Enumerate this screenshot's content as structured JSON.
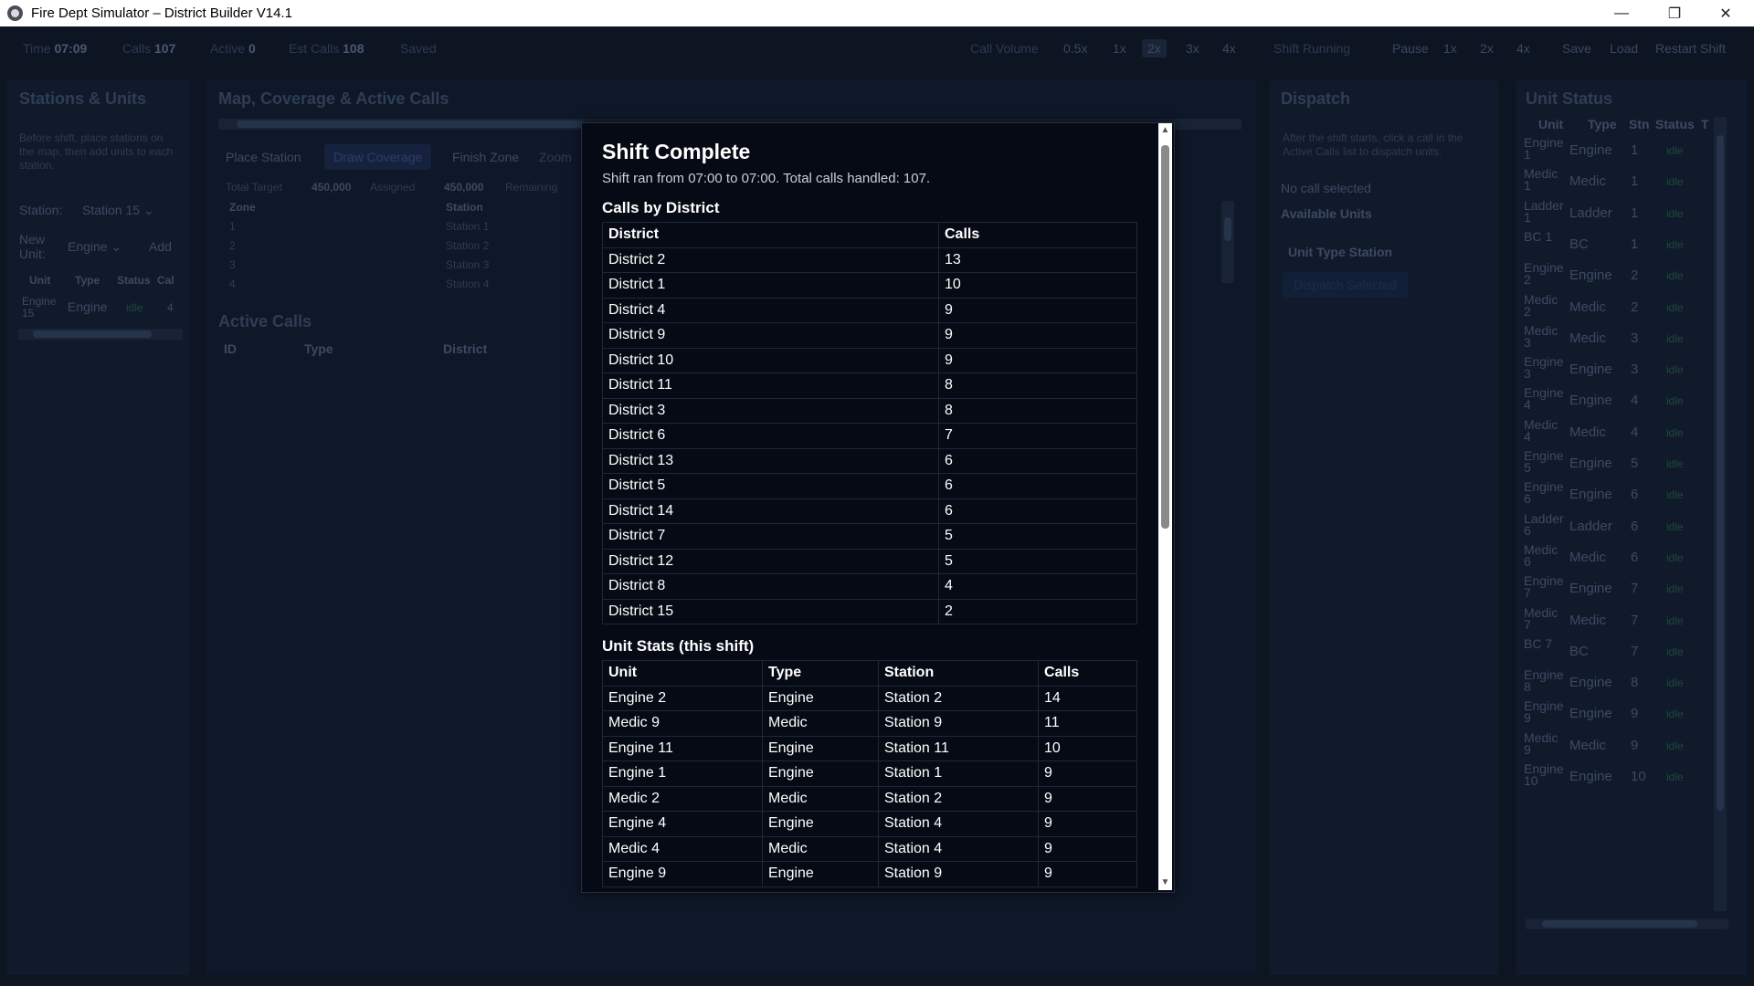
{
  "window": {
    "title": "Fire Dept Simulator – District Builder V14.1",
    "controls": [
      "—",
      "❐",
      "✕"
    ]
  },
  "topbar": {
    "time_label": "Time",
    "time_value": "07:09",
    "calls_label": "Calls",
    "calls_value": "107",
    "active_label": "Active",
    "active_value": "0",
    "est_label": "Est Calls",
    "est_value": "108",
    "saved": "Saved",
    "call_volume_label": "Call Volume",
    "volume_options": [
      "0.5x",
      "1x",
      "2x",
      "3x",
      "4x"
    ],
    "shift_running": "Shift Running",
    "pause": "Pause",
    "speed_options": [
      "1x",
      "2x",
      "4x"
    ],
    "save": "Save",
    "load": "Load",
    "restart": "Restart Shift"
  },
  "stations_panel": {
    "title": "Stations & Units",
    "help": "Before shift, place stations on the map, then add units to each station.",
    "station_label": "Station:",
    "station_value": "Station 15",
    "new_unit_label": "New Unit:",
    "new_unit_value": "Engine",
    "add": "Add",
    "cols": [
      "Unit",
      "Type",
      "Status",
      "Cal"
    ],
    "row": {
      "unit": "Engine 15",
      "type": "Engine",
      "status": "idle",
      "calls": "4"
    }
  },
  "map_panel": {
    "title": "Map, Coverage & Active Calls",
    "tools": [
      "Place Station",
      "Draw Coverage",
      "Finish Zone",
      "Zoom"
    ],
    "total_target_label": "Total Target",
    "total_target": "450,000",
    "assigned_label": "Assigned",
    "assigned": "450,000",
    "remaining_label": "Remaining",
    "zone_cols": [
      "Zone",
      "Station"
    ],
    "zones": [
      [
        "1",
        "Station 1"
      ],
      [
        "2",
        "Station 2"
      ],
      [
        "3",
        "Station 3"
      ],
      [
        "4",
        "Station 4"
      ]
    ],
    "active_calls_title": "Active Calls",
    "active_cols": [
      "ID",
      "Type",
      "District"
    ]
  },
  "dispatch_panel": {
    "title": "Dispatch",
    "help": "After the shift starts, click a call in the Active Calls list to dispatch units.",
    "no_call": "No call selected",
    "available": "Available Units",
    "cols": "Unit Type Station",
    "dispatch_btn": "Dispatch Selected"
  },
  "unit_status": {
    "title": "Unit Status",
    "cols": [
      "Unit",
      "Type",
      "Stn",
      "Status",
      "T"
    ],
    "rows": [
      [
        "Engine 1",
        "Engine",
        "1",
        "idle"
      ],
      [
        "Medic 1",
        "Medic",
        "1",
        "idle"
      ],
      [
        "Ladder 1",
        "Ladder",
        "1",
        "idle"
      ],
      [
        "BC 1",
        "BC",
        "1",
        "idle"
      ],
      [
        "Engine 2",
        "Engine",
        "2",
        "idle"
      ],
      [
        "Medic 2",
        "Medic",
        "2",
        "idle"
      ],
      [
        "Medic 3",
        "Medic",
        "3",
        "idle"
      ],
      [
        "Engine 3",
        "Engine",
        "3",
        "idle"
      ],
      [
        "Engine 4",
        "Engine",
        "4",
        "idle"
      ],
      [
        "Medic 4",
        "Medic",
        "4",
        "idle"
      ],
      [
        "Engine 5",
        "Engine",
        "5",
        "idle"
      ],
      [
        "Engine 6",
        "Engine",
        "6",
        "idle"
      ],
      [
        "Ladder 6",
        "Ladder",
        "6",
        "idle"
      ],
      [
        "Medic 6",
        "Medic",
        "6",
        "idle"
      ],
      [
        "Engine 7",
        "Engine",
        "7",
        "idle"
      ],
      [
        "Medic 7",
        "Medic",
        "7",
        "idle"
      ],
      [
        "BC 7",
        "BC",
        "7",
        "idle"
      ],
      [
        "Engine 8",
        "Engine",
        "8",
        "idle"
      ],
      [
        "Engine 9",
        "Engine",
        "9",
        "idle"
      ],
      [
        "Medic 9",
        "Medic",
        "9",
        "idle"
      ],
      [
        "Engine 10",
        "Engine",
        "10",
        "idle"
      ]
    ]
  },
  "modal": {
    "title": "Shift Complete",
    "summary": "Shift ran from 07:00 to 07:00. Total calls handled: 107.",
    "districts_title": "Calls by District",
    "district_cols": [
      "District",
      "Calls"
    ],
    "districts": [
      [
        "District 2",
        "13"
      ],
      [
        "District 1",
        "10"
      ],
      [
        "District 4",
        "9"
      ],
      [
        "District 9",
        "9"
      ],
      [
        "District 10",
        "9"
      ],
      [
        "District 11",
        "8"
      ],
      [
        "District 3",
        "8"
      ],
      [
        "District 6",
        "7"
      ],
      [
        "District 13",
        "6"
      ],
      [
        "District 5",
        "6"
      ],
      [
        "District 14",
        "6"
      ],
      [
        "District 7",
        "5"
      ],
      [
        "District 12",
        "5"
      ],
      [
        "District 8",
        "4"
      ],
      [
        "District 15",
        "2"
      ]
    ],
    "units_title": "Unit Stats (this shift)",
    "unit_cols": [
      "Unit",
      "Type",
      "Station",
      "Calls"
    ],
    "units": [
      [
        "Engine 2",
        "Engine",
        "Station 2",
        "14"
      ],
      [
        "Medic 9",
        "Medic",
        "Station 9",
        "11"
      ],
      [
        "Engine 11",
        "Engine",
        "Station 11",
        "10"
      ],
      [
        "Engine 1",
        "Engine",
        "Station 1",
        "9"
      ],
      [
        "Medic 2",
        "Medic",
        "Station 2",
        "9"
      ],
      [
        "Engine 4",
        "Engine",
        "Station 4",
        "9"
      ],
      [
        "Medic 4",
        "Medic",
        "Station 4",
        "9"
      ],
      [
        "Engine 9",
        "Engine",
        "Station 9",
        "9"
      ]
    ]
  }
}
